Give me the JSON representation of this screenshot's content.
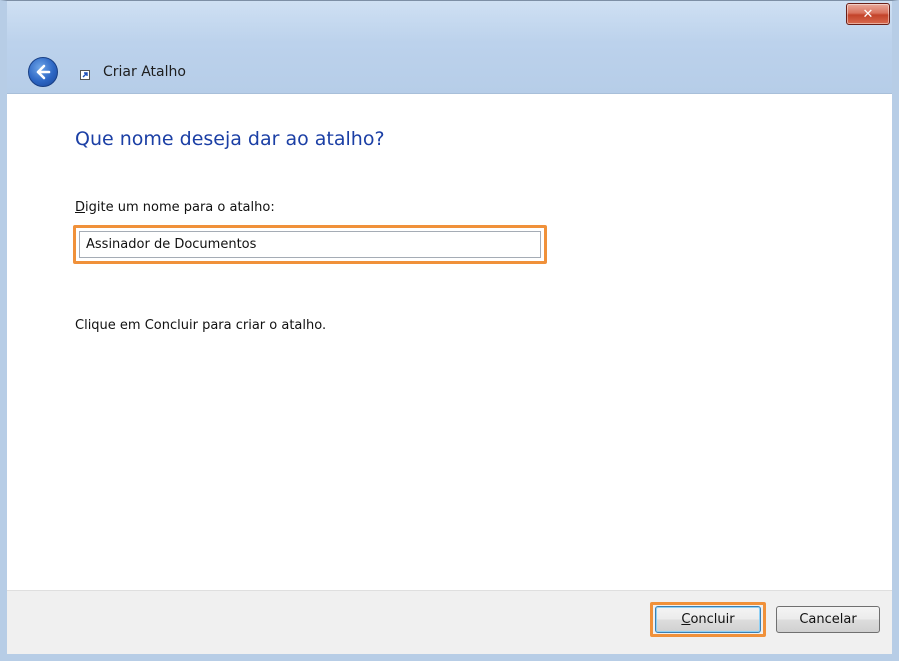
{
  "window": {
    "title": "Criar Atalho",
    "close_label": "✕"
  },
  "main": {
    "heading": "Que nome deseja dar ao atalho?",
    "field_label_first": "D",
    "field_label_rest": "igite um nome para o atalho:",
    "name_value": "Assinador de Documentos",
    "hint": "Clique em Concluir para criar o atalho."
  },
  "footer": {
    "finish_first": "C",
    "finish_rest": "oncluir",
    "cancel_label": "Cancelar"
  },
  "colors": {
    "highlight": "#f0913a",
    "heading": "#1b3fa5"
  },
  "icons": {
    "back": "back-arrow-icon",
    "shortcut": "shortcut-icon",
    "close": "close-icon"
  }
}
